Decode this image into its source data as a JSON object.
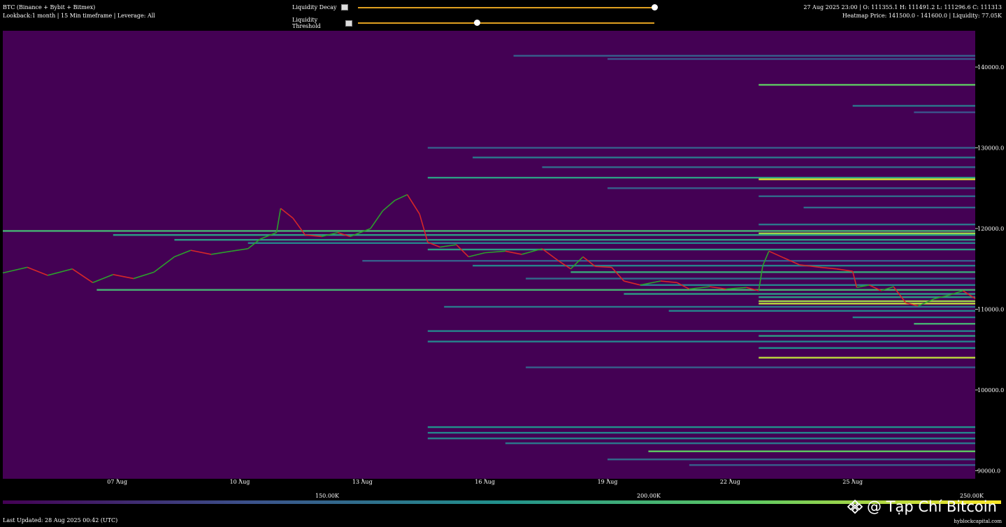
{
  "header": {
    "title": "BTC (Binance + Bybit + Bitmex)",
    "subtitle": "Lookback:1 month | 15 Min timeframe | Leverage: All",
    "ohlc": "27 Aug 2025 23:00 | O: 111355.1 H: 111491.2 L: 111296.6 C: 111313",
    "heatmap_info": "Heatmap Price: 141500.0 - 141600.0 | Liquidity: 77.05K"
  },
  "controls": {
    "decay_label": "Liquidity Decay",
    "threshold_label": "Liquidity Threshold",
    "decay_value": 1.0,
    "threshold_value": 0.4
  },
  "footer": {
    "last_updated": "Last Updated: 28 Aug 2025 00:42 (UTC)",
    "source": "hyblockcapital.com",
    "watermark": "@ Tạp Chí Bitcoin"
  },
  "colorbar": {
    "labels": [
      "150.00K",
      "200.00K",
      "250.00K"
    ]
  },
  "colors": {
    "background": "#440154",
    "up": "#2ca02c",
    "down": "#d62728"
  },
  "chart_data": {
    "type": "heatmap",
    "x_ticks": [
      "07 Aug",
      "10 Aug",
      "13 Aug",
      "16 Aug",
      "19 Aug",
      "22 Aug",
      "25 Aug"
    ],
    "y_ticks": [
      "140000.0",
      "130000.0",
      "120000.0",
      "110000.0",
      "100000.0",
      "90000.0"
    ],
    "y_tick_values": [
      140000,
      130000,
      120000,
      110000,
      100000,
      90000
    ],
    "ylim": [
      89000,
      144500
    ],
    "x_range_days": [
      4.2,
      28.0
    ],
    "price_path": [
      [
        4.2,
        114500
      ],
      [
        4.8,
        115200
      ],
      [
        5.3,
        114200
      ],
      [
        5.9,
        115000
      ],
      [
        6.4,
        113300
      ],
      [
        6.9,
        114300
      ],
      [
        7.4,
        113800
      ],
      [
        7.9,
        114600
      ],
      [
        8.4,
        116500
      ],
      [
        8.8,
        117300
      ],
      [
        9.3,
        116800
      ],
      [
        9.8,
        117200
      ],
      [
        10.2,
        117500
      ],
      [
        10.5,
        118700
      ],
      [
        10.9,
        119500
      ],
      [
        11.0,
        122500
      ],
      [
        11.3,
        121300
      ],
      [
        11.6,
        119200
      ],
      [
        12.0,
        119000
      ],
      [
        12.4,
        119500
      ],
      [
        12.7,
        119000
      ],
      [
        13.2,
        120000
      ],
      [
        13.5,
        122200
      ],
      [
        13.8,
        123500
      ],
      [
        14.1,
        124200
      ],
      [
        14.4,
        121800
      ],
      [
        14.6,
        118300
      ],
      [
        14.9,
        117700
      ],
      [
        15.3,
        118000
      ],
      [
        15.6,
        116500
      ],
      [
        16.0,
        117000
      ],
      [
        16.5,
        117200
      ],
      [
        16.9,
        116800
      ],
      [
        17.4,
        117500
      ],
      [
        17.8,
        116000
      ],
      [
        18.1,
        115000
      ],
      [
        18.4,
        116500
      ],
      [
        18.7,
        115300
      ],
      [
        19.1,
        115200
      ],
      [
        19.4,
        113500
      ],
      [
        19.8,
        113000
      ],
      [
        20.3,
        113500
      ],
      [
        20.7,
        113300
      ],
      [
        21.0,
        112500
      ],
      [
        21.5,
        112800
      ],
      [
        21.9,
        112500
      ],
      [
        22.4,
        112700
      ],
      [
        22.7,
        112300
      ],
      [
        22.8,
        115400
      ],
      [
        22.95,
        117200
      ],
      [
        23.3,
        116400
      ],
      [
        23.7,
        115500
      ],
      [
        24.2,
        115200
      ],
      [
        24.6,
        115000
      ],
      [
        25.0,
        114700
      ],
      [
        25.1,
        112700
      ],
      [
        25.4,
        113000
      ],
      [
        25.7,
        112300
      ],
      [
        26.0,
        112800
      ],
      [
        26.3,
        110800
      ],
      [
        26.6,
        110400
      ],
      [
        27.0,
        111300
      ],
      [
        27.4,
        111800
      ],
      [
        27.7,
        112300
      ],
      [
        28.0,
        111313
      ]
    ],
    "liquidity_levels": [
      {
        "price": 141400,
        "from": 16.7,
        "intensity": 0.3
      },
      {
        "price": 141000,
        "from": 19.0,
        "intensity": 0.25
      },
      {
        "price": 137800,
        "from": 22.7,
        "intensity": 0.75
      },
      {
        "price": 135200,
        "from": 25.0,
        "intensity": 0.4
      },
      {
        "price": 134400,
        "from": 26.5,
        "intensity": 0.25
      },
      {
        "price": 130000,
        "from": 14.6,
        "intensity": 0.3
      },
      {
        "price": 128800,
        "from": 15.7,
        "intensity": 0.4
      },
      {
        "price": 127600,
        "from": 17.4,
        "intensity": 0.35
      },
      {
        "price": 126300,
        "from": 14.6,
        "intensity": 0.55
      },
      {
        "price": 126100,
        "from": 22.7,
        "intensity": 0.95
      },
      {
        "price": 125000,
        "from": 19.0,
        "intensity": 0.3
      },
      {
        "price": 124000,
        "from": 22.7,
        "intensity": 0.35
      },
      {
        "price": 122600,
        "from": 23.8,
        "intensity": 0.35
      },
      {
        "price": 120500,
        "from": 22.7,
        "intensity": 0.4
      },
      {
        "price": 119700,
        "from": 4.2,
        "intensity": 0.65
      },
      {
        "price": 119400,
        "from": 22.7,
        "intensity": 0.85
      },
      {
        "price": 119200,
        "from": 6.9,
        "intensity": 0.55
      },
      {
        "price": 118600,
        "from": 8.4,
        "intensity": 0.55
      },
      {
        "price": 118200,
        "from": 10.2,
        "intensity": 0.45
      },
      {
        "price": 117400,
        "from": 14.6,
        "intensity": 0.55
      },
      {
        "price": 116000,
        "from": 13.0,
        "intensity": 0.3
      },
      {
        "price": 115400,
        "from": 15.7,
        "intensity": 0.45
      },
      {
        "price": 114600,
        "from": 18.1,
        "intensity": 0.6
      },
      {
        "price": 113800,
        "from": 17.0,
        "intensity": 0.35
      },
      {
        "price": 113000,
        "from": 19.8,
        "intensity": 0.45
      },
      {
        "price": 112400,
        "from": 6.5,
        "intensity": 0.65
      },
      {
        "price": 111900,
        "from": 19.4,
        "intensity": 0.55
      },
      {
        "price": 111500,
        "from": 22.7,
        "intensity": 0.55
      },
      {
        "price": 111000,
        "from": 22.7,
        "intensity": 0.85
      },
      {
        "price": 110700,
        "from": 22.7,
        "intensity": 0.9
      },
      {
        "price": 110300,
        "from": 15.0,
        "intensity": 0.4
      },
      {
        "price": 109800,
        "from": 20.5,
        "intensity": 0.45
      },
      {
        "price": 109000,
        "from": 25.0,
        "intensity": 0.45
      },
      {
        "price": 108200,
        "from": 26.5,
        "intensity": 0.65
      },
      {
        "price": 107300,
        "from": 14.6,
        "intensity": 0.45
      },
      {
        "price": 106700,
        "from": 22.7,
        "intensity": 0.55
      },
      {
        "price": 106000,
        "from": 14.6,
        "intensity": 0.45
      },
      {
        "price": 105200,
        "from": 22.7,
        "intensity": 0.5
      },
      {
        "price": 104000,
        "from": 22.7,
        "intensity": 0.9
      },
      {
        "price": 102800,
        "from": 17.0,
        "intensity": 0.3
      },
      {
        "price": 95400,
        "from": 14.6,
        "intensity": 0.5
      },
      {
        "price": 94700,
        "from": 14.6,
        "intensity": 0.45
      },
      {
        "price": 94000,
        "from": 14.6,
        "intensity": 0.45
      },
      {
        "price": 93400,
        "from": 16.5,
        "intensity": 0.4
      },
      {
        "price": 92400,
        "from": 20.0,
        "intensity": 0.75
      },
      {
        "price": 91400,
        "from": 19.0,
        "intensity": 0.35
      },
      {
        "price": 90700,
        "from": 21.0,
        "intensity": 0.3
      }
    ]
  }
}
